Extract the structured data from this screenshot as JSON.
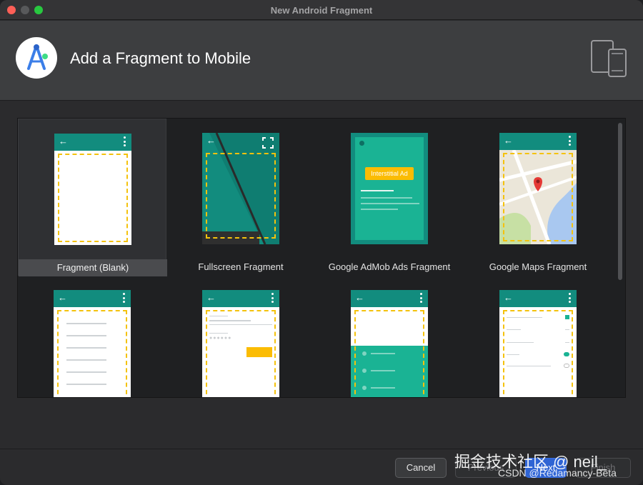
{
  "window": {
    "title": "New Android Fragment"
  },
  "header": {
    "title": "Add a Fragment to Mobile"
  },
  "gallery": {
    "templates": [
      {
        "label": "Fragment (Blank)",
        "selected": true
      },
      {
        "label": "Fullscreen Fragment",
        "selected": false
      },
      {
        "label": "Google AdMob Ads Fragment",
        "selected": false
      },
      {
        "label": "Google Maps Fragment",
        "selected": false
      },
      {
        "label": "",
        "selected": false
      },
      {
        "label": "",
        "selected": false
      },
      {
        "label": "",
        "selected": false
      },
      {
        "label": "",
        "selected": false
      }
    ],
    "admob_badge": "Interstitial Ad"
  },
  "footer": {
    "cancel": "Cancel",
    "previous": "Previous",
    "next": "Next",
    "finish": "Finish"
  },
  "watermark": {
    "line1": "掘金技术社区 @ neil_",
    "line2": "CSDN @Redamancy-Beta"
  },
  "colors": {
    "appbar": "#128c7e",
    "dashed_outline": "#f4c20d",
    "primary_button": "#2f64d4",
    "admob_badge": "#fbbc04"
  }
}
